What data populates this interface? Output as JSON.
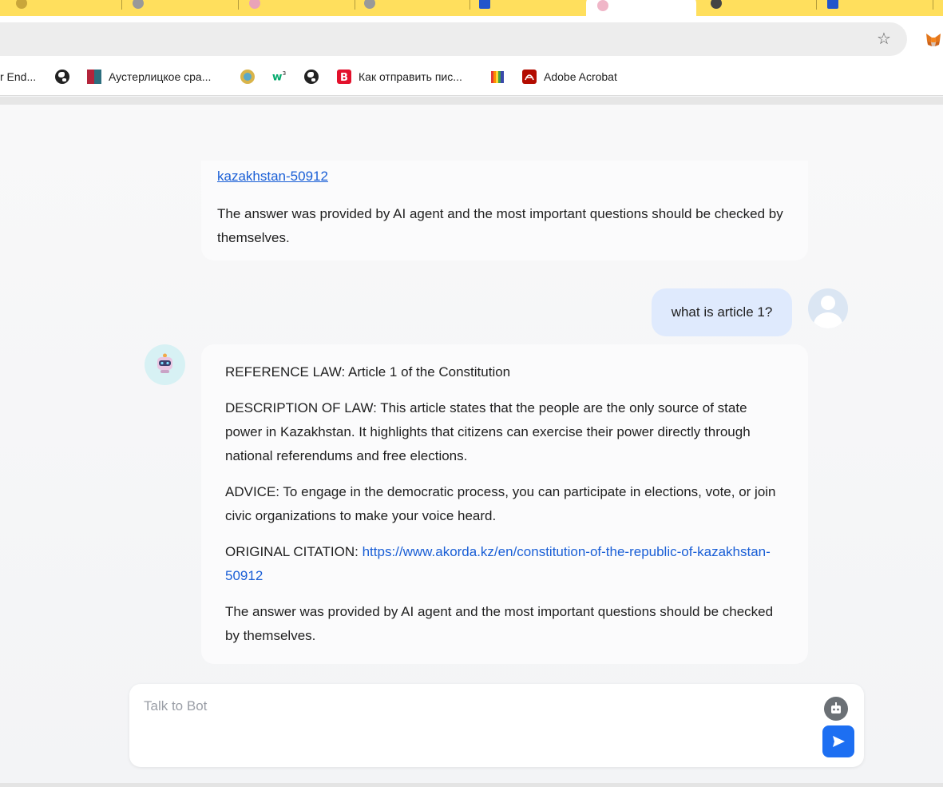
{
  "bookmarks": [
    {
      "label": "r End..."
    },
    {
      "label": ""
    },
    {
      "label": "Аустерлицкое сра..."
    },
    {
      "label": ""
    },
    {
      "label": ""
    },
    {
      "label": ""
    },
    {
      "label": "Как отправить пис..."
    },
    {
      "label": ""
    },
    {
      "label": "Adobe Acrobat"
    }
  ],
  "chat": {
    "previous": {
      "link_text": "kazakhstan-50912",
      "disclaimer": "The answer was provided by AI agent and the most important questions should be checked by themselves."
    },
    "user_message": "what is article 1?",
    "bot_message": {
      "reference": "REFERENCE LAW: Article 1 of the Constitution",
      "description": "DESCRIPTION OF LAW: This article states that the people are the only source of state power in Kazakhstan. It highlights that citizens can exercise their power directly through national referendums and free elections.",
      "advice": "ADVICE: To engage in the democratic process, you can participate in elections, vote, or join civic organizations to make your voice heard.",
      "citation_label": "ORIGINAL CITATION: ",
      "citation_link": "https://www.akorda.kz/en/constitution-of-the-republic-of-kazakhstan-50912",
      "disclaimer": "The answer was provided by AI agent and the most important questions should be checked by themselves."
    }
  },
  "input": {
    "placeholder": "Talk to Bot"
  },
  "colors": {
    "accent": "#1d6ff2",
    "link": "#1a5fd6",
    "user_bubble": "#dfeafd",
    "tab_strip": "#ffdf5d"
  }
}
